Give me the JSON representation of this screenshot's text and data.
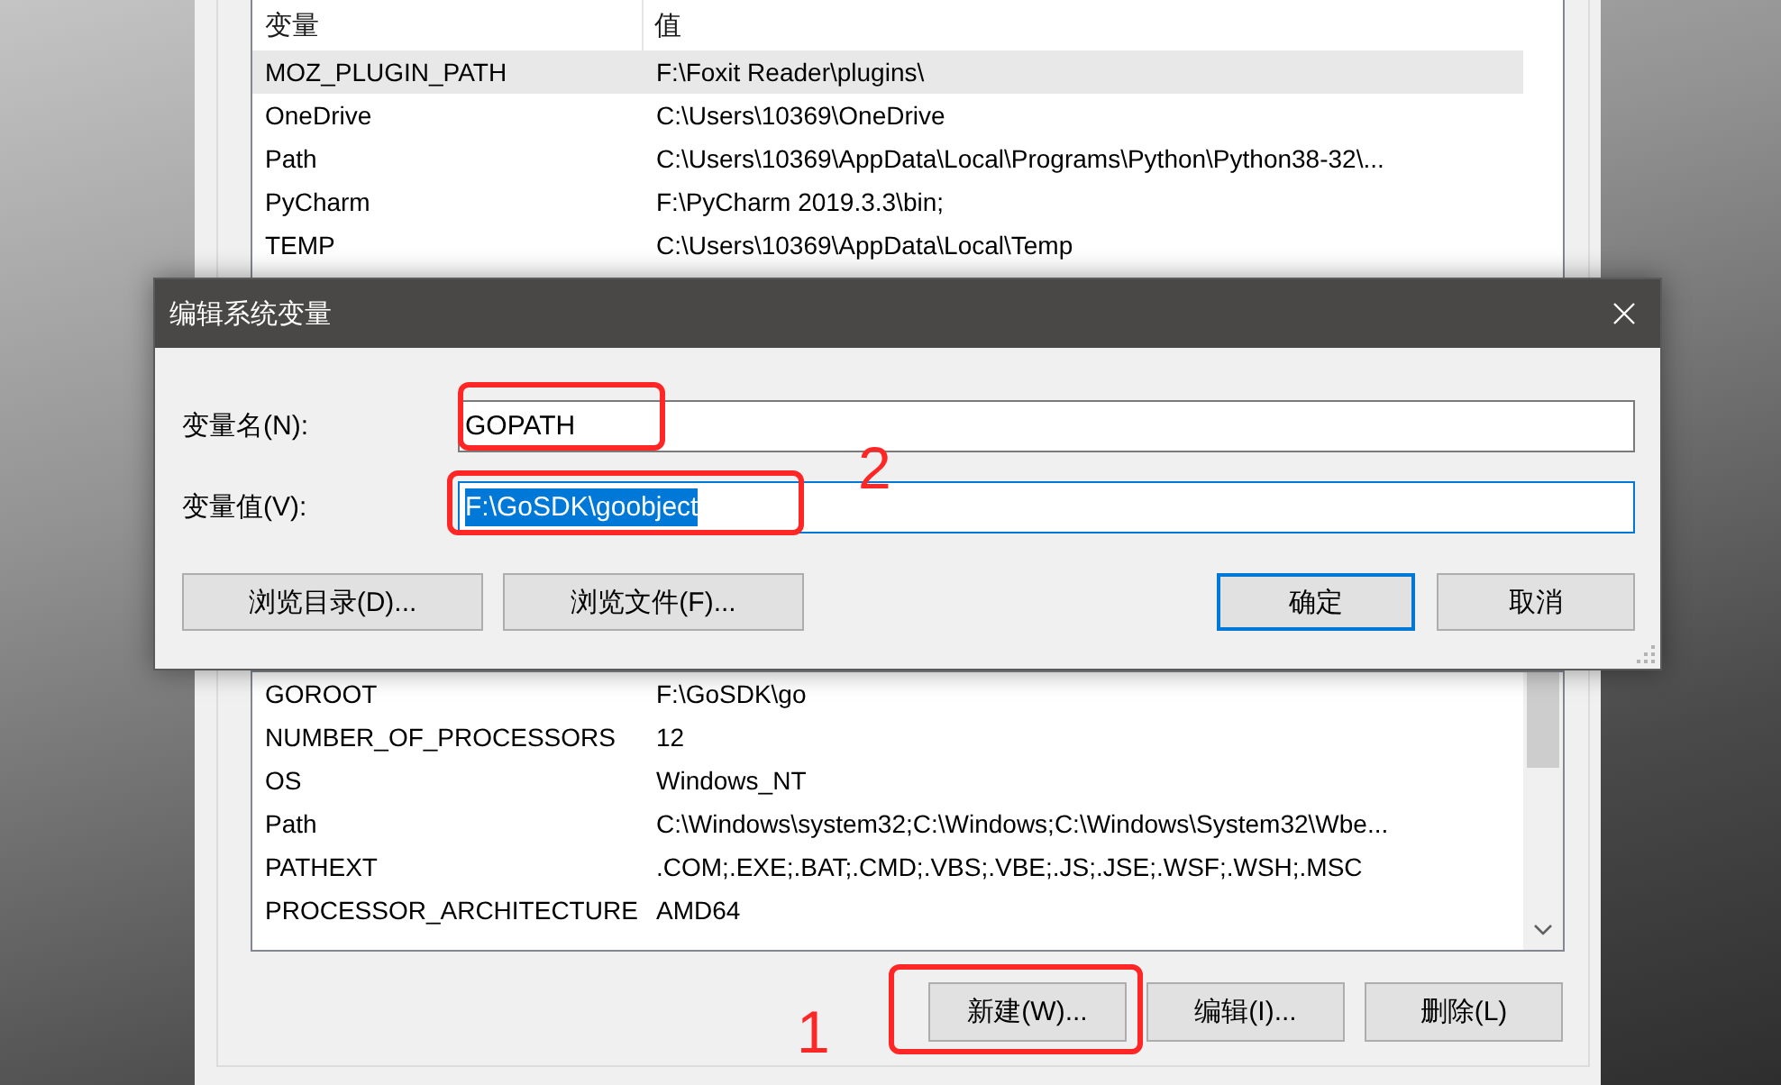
{
  "user_variables": {
    "columns": [
      "变量",
      "值"
    ],
    "rows": [
      {
        "name": "MOZ_PLUGIN_PATH",
        "value": "F:\\Foxit Reader\\plugins\\",
        "selected": true
      },
      {
        "name": "OneDrive",
        "value": "C:\\Users\\10369\\OneDrive",
        "selected": false
      },
      {
        "name": "Path",
        "value": "C:\\Users\\10369\\AppData\\Local\\Programs\\Python\\Python38-32\\...",
        "selected": false
      },
      {
        "name": "PyCharm",
        "value": "F:\\PyCharm 2019.3.3\\bin;",
        "selected": false
      },
      {
        "name": "TEMP",
        "value": "C:\\Users\\10369\\AppData\\Local\\Temp",
        "selected": false
      }
    ]
  },
  "system_variables": {
    "rows": [
      {
        "name": "GOROOT",
        "value": "F:\\GoSDK\\go",
        "selected": false
      },
      {
        "name": "NUMBER_OF_PROCESSORS",
        "value": "12",
        "selected": false
      },
      {
        "name": "OS",
        "value": "Windows_NT",
        "selected": false
      },
      {
        "name": "Path",
        "value": "C:\\Windows\\system32;C:\\Windows;C:\\Windows\\System32\\Wbe...",
        "selected": false
      },
      {
        "name": "PATHEXT",
        "value": ".COM;.EXE;.BAT;.CMD;.VBS;.VBE;.JS;.JSE;.WSF;.WSH;.MSC",
        "selected": false
      },
      {
        "name": "PROCESSOR_ARCHITECTURE",
        "value": "AMD64",
        "selected": false
      }
    ],
    "buttons": [
      {
        "label": "新建(W)...",
        "annotated": true
      },
      {
        "label": "编辑(I)...",
        "annotated": false
      },
      {
        "label": "删除(L)",
        "annotated": false
      }
    ],
    "step_label": "1"
  },
  "dialog": {
    "title": "编辑系统变量",
    "fields": [
      {
        "label": "变量名(N):",
        "value": "GOPATH",
        "focused": false,
        "value_selected": false,
        "annotated": true
      },
      {
        "label": "变量值(V):",
        "value": "F:\\GoSDK\\goobject",
        "focused": true,
        "value_selected": true,
        "annotated": true
      }
    ],
    "step_label": "2",
    "browse_buttons": [
      "浏览目录(D)...",
      "浏览文件(F)..."
    ],
    "buttons": [
      {
        "label": "确定",
        "default": true
      },
      {
        "label": "取消",
        "default": false
      }
    ]
  }
}
